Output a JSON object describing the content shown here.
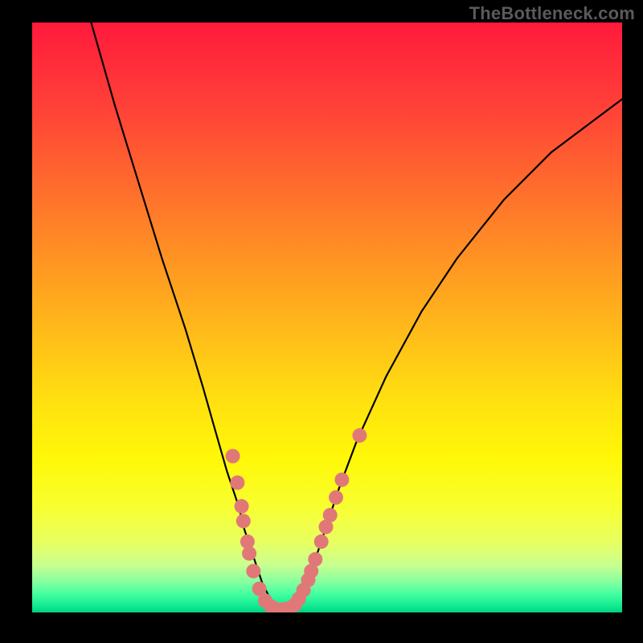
{
  "watermark": "TheBottleneck.com",
  "chart_data": {
    "type": "line",
    "title": "",
    "xlabel": "",
    "ylabel": "",
    "xlim": [
      0,
      100
    ],
    "ylim": [
      0,
      100
    ],
    "grid": false,
    "legend": false,
    "curve": {
      "description": "V-shaped bottleneck curve; high (red) at extremes, dips to zero (green) near x≈42, rises again toward right",
      "x": [
        10,
        14,
        18,
        22,
        26,
        29,
        31,
        33,
        35,
        36,
        37,
        38,
        39,
        40,
        41,
        42,
        43,
        44,
        45,
        46,
        47,
        48,
        50,
        52,
        55,
        60,
        66,
        72,
        80,
        88,
        96,
        100
      ],
      "y": [
        100,
        86,
        73,
        60,
        48,
        38,
        31,
        24,
        18,
        14,
        11,
        8,
        5,
        3,
        1.5,
        0.5,
        0.5,
        1,
        2,
        3.5,
        6,
        9,
        15,
        21,
        29,
        40,
        51,
        60,
        70,
        78,
        84,
        87
      ]
    },
    "markers": {
      "description": "salmon dots clustered on both flanks of the valley",
      "points": [
        {
          "x": 34.0,
          "y": 26.5
        },
        {
          "x": 34.8,
          "y": 22.0
        },
        {
          "x": 35.5,
          "y": 18.0
        },
        {
          "x": 35.8,
          "y": 15.5
        },
        {
          "x": 36.5,
          "y": 12.0
        },
        {
          "x": 36.8,
          "y": 10.0
        },
        {
          "x": 37.5,
          "y": 7.0
        },
        {
          "x": 38.5,
          "y": 4.0
        },
        {
          "x": 39.5,
          "y": 2.0
        },
        {
          "x": 40.5,
          "y": 1.0
        },
        {
          "x": 41.5,
          "y": 0.5
        },
        {
          "x": 42.5,
          "y": 0.5
        },
        {
          "x": 43.5,
          "y": 0.7
        },
        {
          "x": 44.5,
          "y": 1.3
        },
        {
          "x": 45.2,
          "y": 2.3
        },
        {
          "x": 46.0,
          "y": 3.8
        },
        {
          "x": 46.8,
          "y": 5.5
        },
        {
          "x": 47.3,
          "y": 7.0
        },
        {
          "x": 48.0,
          "y": 9.0
        },
        {
          "x": 49.0,
          "y": 12.0
        },
        {
          "x": 49.8,
          "y": 14.5
        },
        {
          "x": 50.5,
          "y": 16.5
        },
        {
          "x": 51.5,
          "y": 19.5
        },
        {
          "x": 52.5,
          "y": 22.5
        },
        {
          "x": 55.5,
          "y": 30.0
        }
      ],
      "radius_px": 9
    },
    "colors": {
      "gradient_top": "#ff1a3c",
      "gradient_mid": "#ffe010",
      "gradient_bottom": "#00d080",
      "curve": "#000000",
      "marker": "#e17878",
      "frame": "#000000"
    }
  }
}
